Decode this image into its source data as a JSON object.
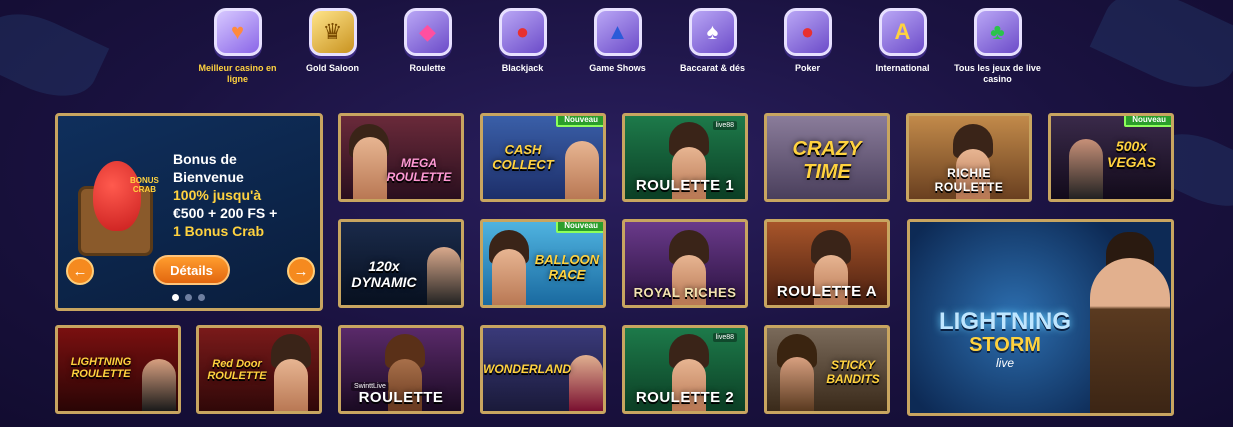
{
  "categories": [
    {
      "label": "Meilleur casino en ligne",
      "icon": "heart-icon",
      "active": true
    },
    {
      "label": "Gold Saloon",
      "icon": "crown-icon",
      "active": false
    },
    {
      "label": "Roulette",
      "icon": "gem-icon",
      "active": false
    },
    {
      "label": "Blackjack",
      "icon": "poker-chip-icon",
      "active": false
    },
    {
      "label": "Game Shows",
      "icon": "top-hat-icon",
      "active": false
    },
    {
      "label": "Baccarat & dés",
      "icon": "spade-card-icon",
      "active": false
    },
    {
      "label": "Poker",
      "icon": "poker-chip-icon",
      "active": false
    },
    {
      "label": "International",
      "icon": "translate-icon",
      "active": false
    },
    {
      "label": "Tous les jeux de live casino",
      "icon": "club-card-icon",
      "active": false
    }
  ],
  "promo": {
    "logo": "BONUS CRAB",
    "line1": "Bonus de",
    "line2": "Bienvenue",
    "line3": "100% jusqu'à",
    "line4": "€500 + 200 FS +",
    "line5": "1 Bonus Crab",
    "button": "Détails",
    "prev": "←",
    "next": "→"
  },
  "badge_new": "Nouveau",
  "games": {
    "g1": {
      "logo": "MEGA ROULETTE"
    },
    "g2": {
      "logo": "CASH COLLECT"
    },
    "g3": {
      "logo": "ROULETTE 1",
      "provider": "live88"
    },
    "g4": {
      "logo": "CRAZY TIME"
    },
    "g5": {
      "logo": "RICHIE ROULETTE"
    },
    "g6": {
      "logo": "500x VEGAS"
    },
    "g7": {
      "logo": "120x DYNAMIC"
    },
    "g8": {
      "logo": "BALLOON RACE"
    },
    "g9": {
      "logo": "ROYAL RICHES"
    },
    "g10": {
      "logo": "ROULETTE A"
    },
    "g11": {
      "logo": "LIGHTNING ROULETTE"
    },
    "g12": {
      "logo": "Red Door ROULETTE"
    },
    "g13": {
      "logo": "ROULETTE",
      "provider": "SwinttLive"
    },
    "g14": {
      "logo": "WONDERLAND"
    },
    "g15": {
      "logo": "ROULETTE 2",
      "provider": "live88"
    },
    "g16": {
      "logo": "STICKY BANDITS"
    },
    "big": {
      "logo1": "LIGHTNING",
      "logo2": "STORM",
      "logo3": "live"
    }
  }
}
